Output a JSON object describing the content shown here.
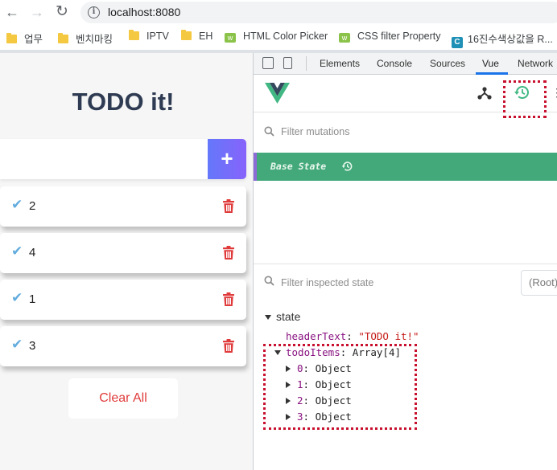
{
  "browser": {
    "url": "localhost:8080",
    "bookmarks": [
      {
        "label": "업무",
        "icon": "folder-icon"
      },
      {
        "label": "벤치마킹",
        "icon": "folder-icon"
      },
      {
        "label": "IPTV",
        "icon": "folder-icon"
      },
      {
        "label": "EH",
        "icon": "folder-icon"
      },
      {
        "label": "HTML Color Picker",
        "icon": "w3schools-icon"
      },
      {
        "label": "CSS filter Property",
        "icon": "w3schools-icon"
      },
      {
        "label": "16진수색상값을 R...",
        "icon": "site-c-icon"
      }
    ]
  },
  "app": {
    "title": "TODO it!",
    "input_value": "",
    "add_label": "+",
    "todos": [
      {
        "text": "2",
        "done": true
      },
      {
        "text": "4",
        "done": true
      },
      {
        "text": "1",
        "done": true
      },
      {
        "text": "3",
        "done": true
      }
    ],
    "clear_label": "Clear All",
    "colors": {
      "title": "#2f3b52",
      "check": "#62acde",
      "trash": "#e03b3b",
      "add_from": "#6478fb",
      "add_to": "#8763fb"
    }
  },
  "devtools": {
    "tabs": [
      "Elements",
      "Console",
      "Sources",
      "Vue",
      "Network"
    ],
    "active_tab": "Vue",
    "mutations_placeholder": "Filter mutations",
    "base_state_label": "Base State",
    "state_placeholder": "Filter inspected state",
    "root_select": "(Root)",
    "state_label": "state",
    "header_key": "headerText",
    "header_value": "\"TODO it!\"",
    "todo_key": "todoItems",
    "todo_type": "Array[4]",
    "items": [
      {
        "key": "0",
        "type": "Object"
      },
      {
        "key": "1",
        "type": "Object"
      },
      {
        "key": "2",
        "type": "Object"
      },
      {
        "key": "3",
        "type": "Object"
      }
    ],
    "colors": {
      "vue_green": "#41b883",
      "vue_dark": "#35495e",
      "base_state_bg": "#44a97a",
      "highlight_border": "#c8102e"
    }
  }
}
